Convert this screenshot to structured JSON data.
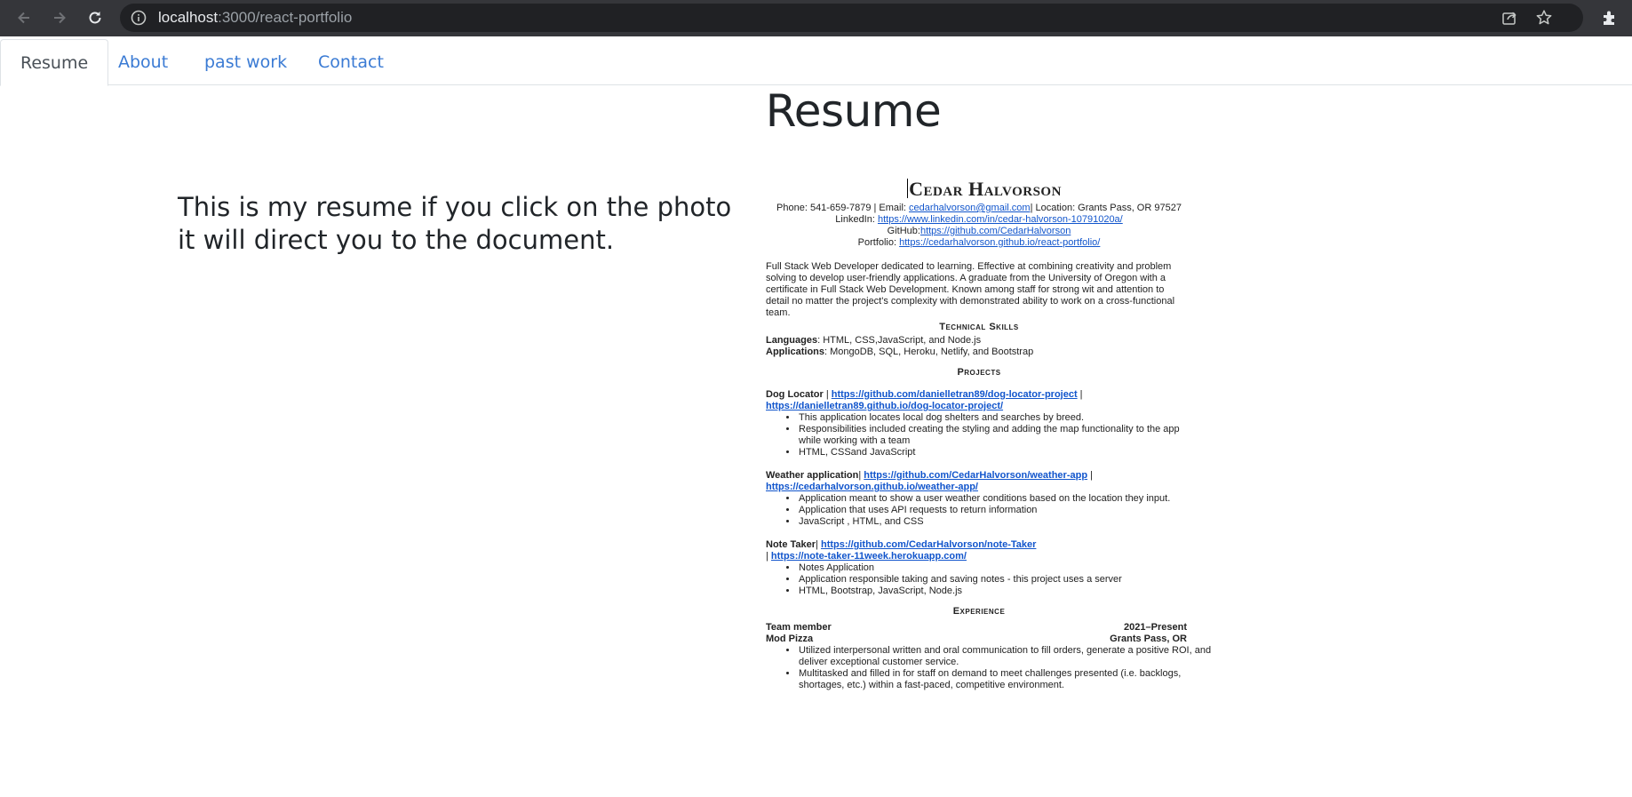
{
  "browser": {
    "url_host": "localhost",
    "url_path": ":3000/react-portfolio"
  },
  "tabs": [
    {
      "label": "Resume",
      "active": true
    },
    {
      "label": "About",
      "active": false
    },
    {
      "label": "past work",
      "active": false
    },
    {
      "label": "Contact",
      "active": false
    }
  ],
  "page": {
    "title": "Resume",
    "intro": "This is my resume if you click on the photo it will direct you to the document."
  },
  "resume": {
    "name": "Cedar Halvorson",
    "phone_line_a": "Phone: 541-659-7879 | Email: ",
    "email": "cedarhalvorson@gmail.com",
    "phone_line_b": "| Location: Grants Pass, OR 97527",
    "linkedin_label": "LinkedIn: ",
    "linkedin_url": "https://www.linkedin.com/in/cedar-halvorson-10791020a/",
    "github_label": "GitHub:",
    "github_url": "https://github.com/CedarHalvorson",
    "portfolio_label": "Portfolio: ",
    "portfolio_url": "https://cedarhalvorson.github.io/react-portfolio/",
    "summary": "Full Stack Web Developer dedicated to learning. Effective at combining creativity and problem solving to develop user-friendly applications. A graduate from the University of Oregon with a certificate in Full Stack Web Development. Known among staff for strong wit and attention to detail no matter the project's complexity with demonstrated ability to work on a cross-functional team.",
    "skills_heading": "Technical Skills",
    "languages_label": "Languages",
    "languages": ": HTML, CSS,JavaScript, and Node.js",
    "applications_label": "Applications",
    "applications": ": MongoDB, SQL, Heroku, Netlify, and Bootstrap",
    "projects_heading": "Projects",
    "projects": [
      {
        "name": "Dog Locator",
        "sep": " | ",
        "repo": "https://github.com/danielletran89/dog-locator-project",
        "sep2": " |",
        "lead": "",
        "live": "https://danielletran89.github.io/dog-locator-project/",
        "bullets": [
          "This application locates local dog shelters and searches by breed.",
          "Responsibilities included creating the styling and adding the map functionality to the app while working with a team",
          "HTML, CSSand JavaScript"
        ]
      },
      {
        "name": "Weather application",
        "sep": "| ",
        "repo": "https://github.com/CedarHalvorson/weather-app",
        "sep2": " |",
        "lead": "",
        "live": "https://cedarhalvorson.github.io/weather-app/",
        "bullets": [
          "Application meant to show a user weather conditions based on the location they input.",
          "Application that uses API requests to return information",
          "JavaScript , HTML, and CSS"
        ]
      },
      {
        "name": "Note Taker",
        "sep": "| ",
        "repo": "https://github.com/CedarHalvorson/note-Taker",
        "sep2": "",
        "lead": "| ",
        "live": "https://note-taker-11week.herokuapp.com/",
        "bullets": [
          "Notes Application",
          "Application responsible taking and saving notes - this project uses a server",
          "HTML, Bootstrap, JavaScript, Node.js"
        ]
      }
    ],
    "experience_heading": "Experience",
    "role": "Team member",
    "dates": "2021–Present",
    "company": "Mod Pizza",
    "location": "Grants Pass, OR",
    "exp_bullets": [
      "Utilized interpersonal written and oral communication to fill orders, generate a positive ROI, and deliver exceptional customer service.",
      "Multitasked and filled in for staff on demand to meet challenges presented (i.e. backlogs, shortages, etc.) within a fast-paced, competitive environment."
    ]
  },
  "icons": {
    "back": "arrow-left-icon",
    "forward": "arrow-right-icon",
    "reload": "reload-icon",
    "site_info": "info-icon",
    "share": "share-icon",
    "bookmark": "star-icon",
    "extensions": "puzzle-icon"
  }
}
